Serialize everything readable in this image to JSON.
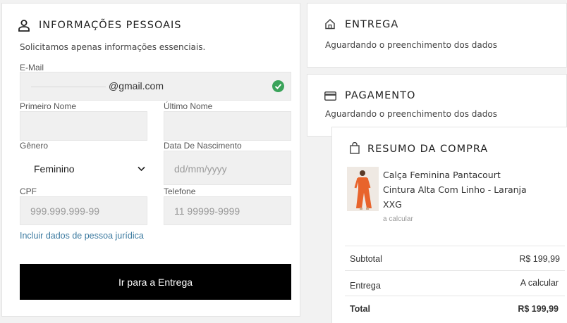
{
  "personal": {
    "title": "INFORMAÇÕES PESSOAIS",
    "subtitle": "Solicitamos apenas informações essenciais.",
    "email_label": "E-Mail",
    "email_value": "@gmail.com",
    "first_name_label": "Primeiro Nome",
    "last_name_label": "Último Nome",
    "gender_label": "Gênero",
    "gender_value": "Feminino",
    "birth_label": "Data De Nascimento",
    "birth_placeholder": "dd/mm/yyyy",
    "cpf_label": "CPF",
    "cpf_placeholder": "999.999.999-99",
    "phone_label": "Telefone",
    "phone_placeholder": "11 99999-9999",
    "company_link": "Incluir dados de pessoa jurídica",
    "submit_label": "Ir para a Entrega"
  },
  "delivery": {
    "title": "ENTREGA",
    "status": "Aguardando o preenchimento dos dados"
  },
  "payment": {
    "title": "PAGAMENTO",
    "status": "Aguardando o preenchimento dos dados"
  },
  "summary": {
    "title": "RESUMO DA COMPRA",
    "product_line1": "Calça Feminina Pantacourt",
    "product_line2": "Cintura Alta Com Linho - Laranja",
    "size": "XXG",
    "shipping_note": "a calcular",
    "subtotal_label": "Subtotal",
    "subtotal_value": "R$ 199,99",
    "delivery_label": "Entrega",
    "delivery_value": "A calcular",
    "total_label": "Total",
    "total_value": "R$ 199,99"
  },
  "colors": {
    "check": "#3aa35a",
    "button": "#000000",
    "link": "#3c7aa0",
    "product": "#e8642c"
  }
}
